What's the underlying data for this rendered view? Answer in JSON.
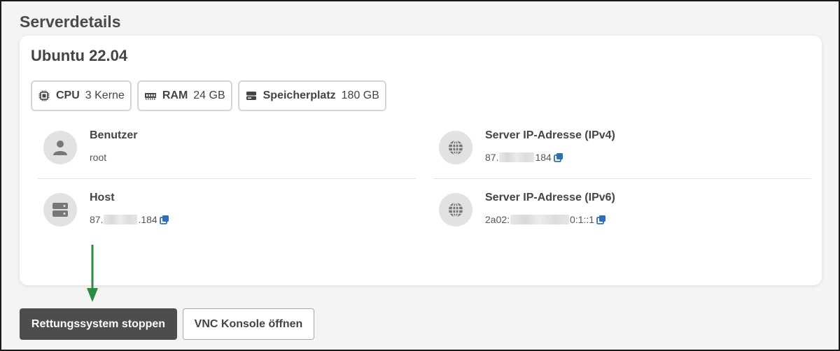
{
  "section": {
    "title": "Serverdetails"
  },
  "server": {
    "os": "Ubuntu 22.04",
    "specs": [
      {
        "label": "CPU",
        "value": "3 Kerne",
        "icon": "cpu-icon"
      },
      {
        "label": "RAM",
        "value": "24 GB",
        "icon": "ram-icon"
      },
      {
        "label": "Speicherplatz",
        "value": "180 GB",
        "icon": "storage-icon"
      }
    ]
  },
  "details": {
    "user": {
      "title": "Benutzer",
      "value": "root",
      "icon": "user-icon"
    },
    "host": {
      "title": "Host",
      "value_prefix": "87.",
      "value_suffix": ".184",
      "icon": "server-icon"
    },
    "ipv4": {
      "title": "Server IP-Adresse (IPv4)",
      "value_prefix": "87.",
      "value_suffix": "184",
      "icon": "globe-icon"
    },
    "ipv6": {
      "title": "Server IP-Adresse (IPv6)",
      "value_prefix": "2a02:",
      "value_suffix": "0:1::1",
      "icon": "globe-icon"
    }
  },
  "actions": {
    "stop_rescue": "Rettungssystem stoppen",
    "open_vnc": "VNC Konsole öffnen"
  },
  "colors": {
    "primary_button": "#4d4d4d",
    "copy_icon": "#2f6fb5",
    "annotation_arrow": "#2e8b3e"
  }
}
